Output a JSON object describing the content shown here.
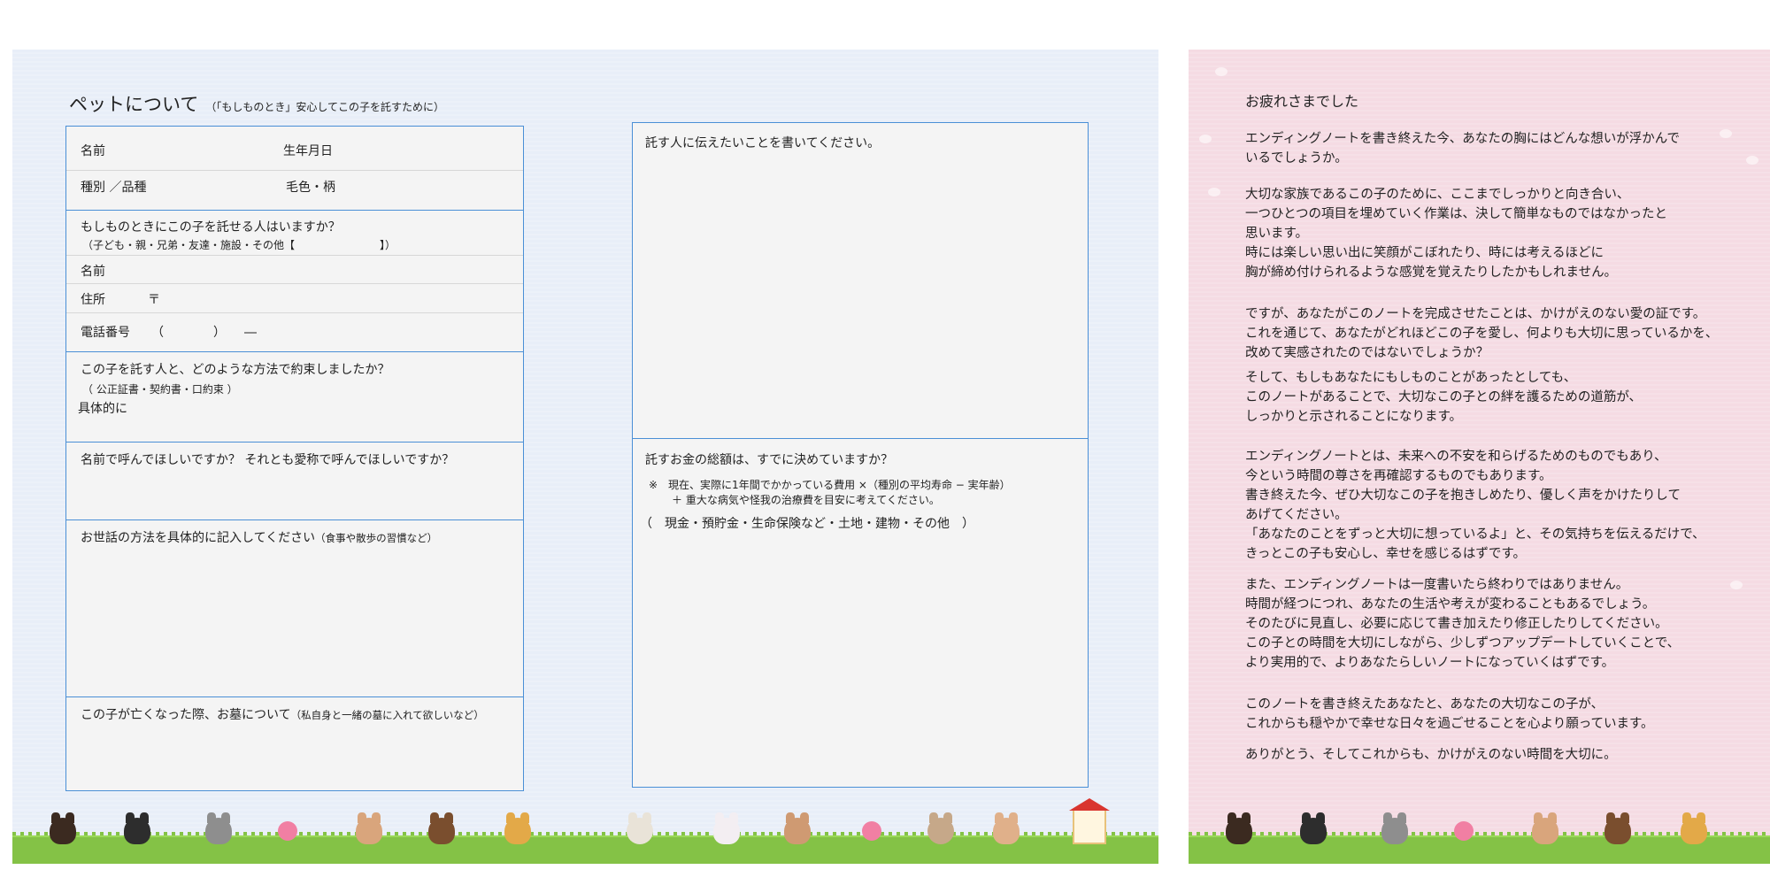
{
  "left": {
    "title": "ペットについて",
    "title_note": "（「もしものとき」安心してこの子を託すために）",
    "form": {
      "name": "名前",
      "birthday": "生年月日",
      "species": "種別 ／品種",
      "fur_color": "毛色・柄",
      "trust_question": "もしものときにこの子を託せる人はいますか？",
      "trust_options": "（子ども・親・兄弟・友達・施設・その他【　　　　　　　　】）",
      "trust_name": "名前",
      "address": "住所",
      "postal_mark": "〒",
      "phone": "電話番号",
      "phone_format": "（　　　　）　　―",
      "promise_question": "この子を託す人と、どのような方法で約束しましたか？",
      "promise_options": "（ 公正証書・契約書・口約束 ）",
      "promise_detail": "具体的に",
      "call_name_question": "名前で呼んでほしいですか？ それとも愛称で呼んでほしいですか？",
      "care_question": "お世話の方法を具体的に記入してください",
      "care_note": "（食事や散歩の習慣など）",
      "grave_question": "この子が亡くなった際、お墓について",
      "grave_note": "（私自身と一緒の墓に入れて欲しいなど）"
    },
    "message": {
      "prompt": "託す人に伝えたいことを書いてください。",
      "money_question": "託すお金の総額は、すでに決めていますか？",
      "money_note_1": "※　現在、実際に1年間でかかっている費用 ×（種別の平均寿命 − 実年齢）",
      "money_note_2": "＋ 重大な病気や怪我の治療費を目安に考えてください。",
      "money_sources": "（　現金・預貯金・生命保険など・土地・建物・その他　）"
    }
  },
  "right": {
    "heading": "お疲れさまでした",
    "paragraphs": [
      [
        "エンディングノートを書き終えた今、あなたの胸にはどんな想いが浮かんで",
        "いるでしょうか。"
      ],
      [
        "大切な家族であるこの子のために、ここまでしっかりと向き合い、",
        "一つひとつの項目を埋めていく作業は、決して簡単なものではなかったと",
        "思います。",
        "時には楽しい思い出に笑顔がこぼれたり、時には考えるほどに",
        "胸が締め付けられるような感覚を覚えたりしたかもしれません。"
      ],
      [
        "ですが、あなたがこのノートを完成させたことは、かけがえのない愛の証です。",
        "これを通じて、あなたがどれほどこの子を愛し、何よりも大切に思っているかを、",
        "改めて実感されたのではないでしょうか？"
      ],
      [
        "そして、もしもあなたにもしものことがあったとしても、",
        "このノートがあることで、大切なこの子との絆を護るための道筋が、",
        "しっかりと示されることになります。"
      ],
      [
        "エンディングノートとは、未来への不安を和らげるためのものでもあり、",
        "今という時間の尊さを再確認するものでもあります。",
        "書き終えた今、ぜひ大切なこの子を抱きしめたり、優しく声をかけたりして",
        "あげてください。",
        "「あなたのことをずっと大切に想っているよ」と、その気持ちを伝えるだけで、",
        "きっとこの子も安心し、幸せを感じるはずです。"
      ],
      [
        "また、エンディングノートは一度書いたら終わりではありません。",
        "時間が経つにつれ、あなたの生活や考えが変わることもあるでしょう。",
        "そのたびに見直し、必要に応じて書き加えたり修正したりしてください。",
        "この子との時間を大切にしながら、少しずつアップデートしていくことで、",
        "より実用的で、よりあなたらしいノートになっていくはずです。"
      ],
      [
        "このノートを書き終えたあなたと、あなたの大切なこの子が、",
        "これからも穏やかで幸せな日々を過ごせることを心より願っています。"
      ],
      [
        "ありがとう、そしてこれからも、かけがえのない時間を大切に。"
      ]
    ]
  },
  "colors": {
    "left_bg": "#e8eef8",
    "right_bg": "#f5dbe3",
    "border": "#4a8fd6",
    "grass": "#84c246"
  },
  "decorations": [
    "dog-icon",
    "cat-icon",
    "paw-icon",
    "owl-icon",
    "rabbit-icon",
    "hedgehog-icon",
    "doghouse-icon"
  ]
}
